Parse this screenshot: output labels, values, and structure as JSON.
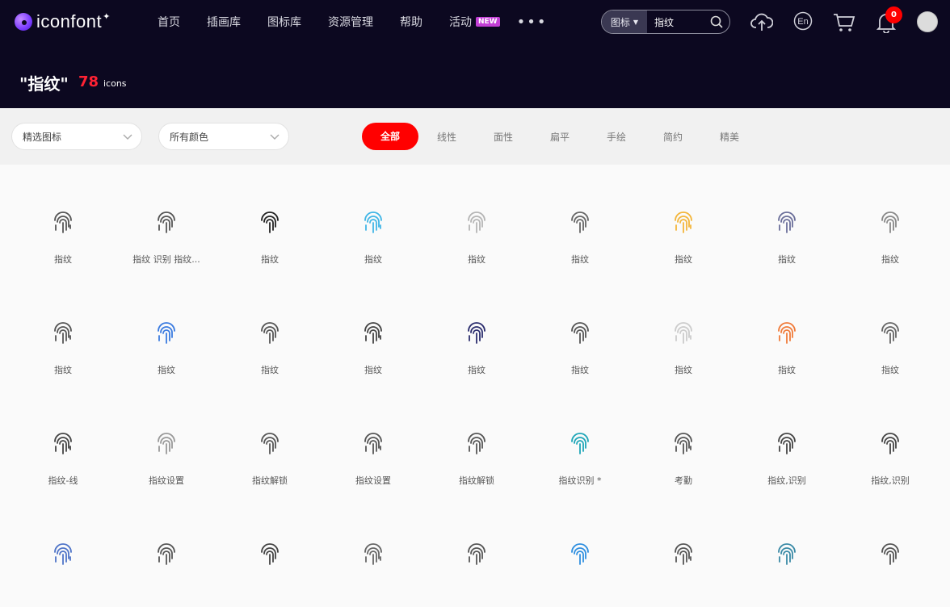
{
  "nav": {
    "logo": "iconfont",
    "items": [
      "首页",
      "插画库",
      "图标库",
      "资源管理",
      "帮助",
      "活动"
    ],
    "new_badge": "NEW",
    "more": "•••",
    "search_type": "图标",
    "search_value": "指纹",
    "notification_count": "0"
  },
  "hero": {
    "query": "\"指纹\"",
    "count": "78",
    "unit": "icons"
  },
  "filters": {
    "select_featured": "精选图标",
    "select_color": "所有颜色",
    "style_tabs": [
      "全部",
      "线性",
      "面性",
      "扁平",
      "手绘",
      "简约",
      "精美"
    ]
  },
  "icons": [
    {
      "label": "指纹",
      "color": "#555555"
    },
    {
      "label": "指纹 识别 指纹...",
      "color": "#555555"
    },
    {
      "label": "指纹",
      "color": "#222222"
    },
    {
      "label": "指纹",
      "color": "#41b6e6"
    },
    {
      "label": "指纹",
      "color": "#b5b5b5"
    },
    {
      "label": "指纹",
      "color": "#666666"
    },
    {
      "label": "指纹",
      "color": "#f3b63b"
    },
    {
      "label": "指纹",
      "color": "#6b6f9a"
    },
    {
      "label": "指纹",
      "color": "#888888"
    },
    {
      "label": "指纹",
      "color": "#555555"
    },
    {
      "label": "指纹",
      "color": "#3a7be0"
    },
    {
      "label": "指纹",
      "color": "#555555"
    },
    {
      "label": "指纹",
      "color": "#444444"
    },
    {
      "label": "指纹",
      "color": "#2b2d6e"
    },
    {
      "label": "指纹",
      "color": "#555555"
    },
    {
      "label": "指纹",
      "color": "#cccccc"
    },
    {
      "label": "指纹",
      "color": "#f07b3a"
    },
    {
      "label": "指纹",
      "color": "#666666"
    },
    {
      "label": "指纹-线",
      "color": "#444444"
    },
    {
      "label": "指纹设置",
      "color": "#999999"
    },
    {
      "label": "指纹解锁",
      "color": "#555555"
    },
    {
      "label": "指纹设置",
      "color": "#555555"
    },
    {
      "label": "指纹解锁",
      "color": "#555555"
    },
    {
      "label": "指纹识别 *",
      "color": "#1ea6b8"
    },
    {
      "label": "考勤",
      "color": "#555555"
    },
    {
      "label": "指纹,识别",
      "color": "#444444"
    },
    {
      "label": "指纹,识别",
      "color": "#444444"
    },
    {
      "label": "",
      "color": "#4f74c8"
    },
    {
      "label": "",
      "color": "#555555"
    },
    {
      "label": "",
      "color": "#444444"
    },
    {
      "label": "",
      "color": "#666666"
    },
    {
      "label": "",
      "color": "#555555"
    },
    {
      "label": "",
      "color": "#2f8fe0"
    },
    {
      "label": "",
      "color": "#555555"
    },
    {
      "label": "",
      "color": "#3a8aa6"
    },
    {
      "label": "",
      "color": "#555555"
    }
  ]
}
